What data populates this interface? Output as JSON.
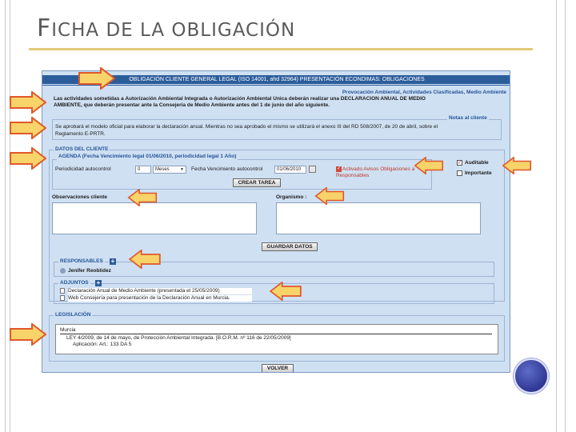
{
  "slide": {
    "title_first": "F",
    "title_rest": "ICHA DE LA OBLIGACIÓN"
  },
  "app": {
    "header": "OBLIGACIÓN CLIENTE GENERAL LEGAL (ISO 14001, ahd 32964) PRESENTACIÓN ECONDIMAS: OBLIGACIONES",
    "province_line": "Provocación Ambiental, Actividades Clasificadas, Medio Ambiente",
    "description_line1": "Las actividades sometidas a Autorización Ambiental Integrada o Autorización Ambiental Única deberán realizar una DECLARACIÓN ANUAL DE MEDIO",
    "description_line2": "AMBIENTE, que deberán presentar ante la Consejería de Medio Ambiente antes del 1 de junio del año siguiente.",
    "notes_legend": "Notas al cliente",
    "notes_line1": "Se aprobará el modelo oficial para elaborar la declaración anual. Mientras no sea aprobado el mismo se utilizará el anexo III del RD 508/2007, de 20 de abril, sobre el",
    "notes_line2": "Reglamento E-PRTR.",
    "client_legend": "DATOS DEL CLIENTE",
    "agenda_legend": "AGENDA (Fecha Vencimiento legal 01/06/2010, periodicidad legal 1 Año)",
    "periodicity_label": "Periodicidad autocontrol",
    "periodicity_value": "0",
    "periodicity_unit": "Meses",
    "due_date_label": "Fecha Vencimiento autocontrol",
    "due_date_value": "01/06/2010",
    "notify_label_line1": "Activado Avisos Obligaciones a",
    "notify_label_line2": "Responsables",
    "auditable_label": "Auditable",
    "important_label": "Importante",
    "create_task_button": "CREAR TAREA",
    "observations_label": "Observaciones cliente",
    "organism_label": "Organismo :",
    "save_button": "GUARDAR DATOS",
    "responsables_legend": "RESPONSABLES",
    "responsable_name": "Jenifer Reoblidez",
    "adjuntos_legend": "ADJUNTOS",
    "attachment_1": "Declaración Anual de Medio Ambiente (presentada el 25/05/2009)",
    "attachment_2": "Web Consejería para presentación de la Declaración Anual en Murcia.",
    "legislacion_legend": "LEGISLACIÓN",
    "legis_region": "Murcia",
    "legis_law": "LEY 4/2009, de 14 de mayo, de Protección Ambiental Integrada. [B.O.R.M. nº 116 de 22/05/2009]",
    "legis_application": "Aplicación: Art.: 133 DA 5",
    "back_button": "VOLVER"
  },
  "colors": {
    "panel_bg": "#cfe0f2",
    "header_bg": "#2c5d9b",
    "arrow_fill": "#f7d36a",
    "arrow_stroke": "#e0572a",
    "title_rule": "#e4c878"
  },
  "icons": {
    "arrow": "arrow-right-callout-icon",
    "plus": "plus-icon",
    "calendar": "calendar-icon",
    "document": "document-icon",
    "user": "user-icon",
    "orb": "decorative-orb"
  }
}
